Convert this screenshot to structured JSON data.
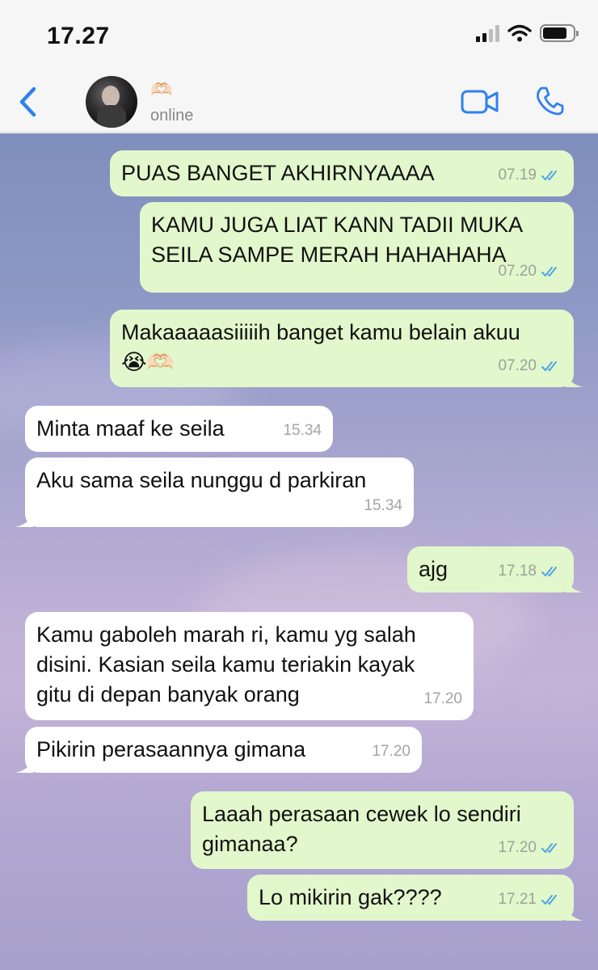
{
  "status_bar": {
    "time": "17.27"
  },
  "header": {
    "contact_name_emoji": "🫶🏻",
    "contact_status": "online"
  },
  "colors": {
    "accent": "#2f80ed",
    "outgoing_bubble": "#e2f7cb",
    "incoming_bubble": "#ffffff",
    "read_ticks": "#4fa6e6"
  },
  "messages": [
    {
      "direction": "out",
      "text": "PUAS BANGET AKHIRNYAAAA",
      "time": "07.19",
      "read": true
    },
    {
      "direction": "out",
      "text": "KAMU JUGA LIAT KANN TADII MUKA\nSEILA SAMPE MERAH HAHAHAHA",
      "time": "07.20",
      "read": true
    },
    {
      "direction": "out",
      "text": "Makaaaaasiiiiih banget kamu belain akuu\n😭🫶🏻",
      "time": "07.20",
      "read": true
    },
    {
      "direction": "in",
      "text": "Minta maaf ke seila",
      "time": "15.34"
    },
    {
      "direction": "in",
      "text": "Aku sama seila nunggu d parkiran",
      "time": "15.34"
    },
    {
      "direction": "out",
      "text": "ajg",
      "time": "17.18",
      "read": true
    },
    {
      "direction": "in",
      "text": "Kamu gaboleh marah ri, kamu yg salah\ndisini. Kasian seila kamu teriakin kayak\ngitu di depan banyak orang",
      "time": "17.20"
    },
    {
      "direction": "in",
      "text": "Pikirin perasaannya gimana",
      "time": "17.20"
    },
    {
      "direction": "out",
      "text": "Laaah perasaan cewek lo sendiri\ngimanaa?",
      "time": "17.20",
      "read": true
    },
    {
      "direction": "out",
      "text": "Lo mikirin gak????",
      "time": "17.21",
      "read": true
    }
  ]
}
